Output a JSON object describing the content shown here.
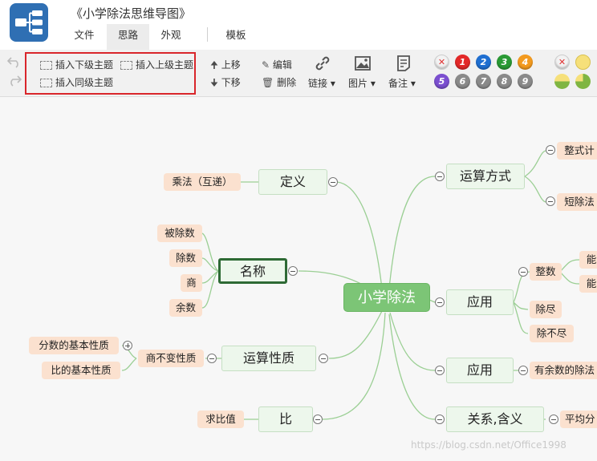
{
  "app": {
    "title": "《小学除法思维导图》"
  },
  "menu_tabs": [
    "文件",
    "思路",
    "外观",
    "模板"
  ],
  "active_tab": "思路",
  "toolbar": {
    "insert_child": "插入下级主题",
    "insert_parent": "插入上级主题",
    "insert_sibling": "插入同级主题",
    "move_up": "上移",
    "move_down": "下移",
    "edit": "编辑",
    "delete": "删除",
    "link": "链接",
    "image": "图片",
    "note": "备注",
    "priorities": [
      "1",
      "2",
      "3",
      "4",
      "5",
      "6",
      "7",
      "8",
      "9"
    ],
    "priority_colors": [
      "#e32828",
      "#1f6fd1",
      "#2a9a35",
      "#f39a1e",
      "#7b4fd0",
      "#8a8a8a",
      "#8a8a8a",
      "#8a8a8a",
      "#8a8a8a"
    ]
  },
  "mindmap": {
    "root": "小学除法",
    "nodes": {
      "definition": "定义",
      "names": "名称",
      "property": "运算性质",
      "ratio": "比",
      "method": "运算方式",
      "application1": "应用",
      "application2": "应用",
      "relation": "关系,含义"
    },
    "leaves": {
      "reciprocal": "乘法（互递）",
      "dividend": "被除数",
      "divisor": "除数",
      "quotient": "商",
      "remainder": "余数",
      "invariant": "商不变性质",
      "fraction_prop": "分数的基本性质",
      "ratio_prop": "比的基本性质",
      "ratio_value": "求比值",
      "integer_calc": "整式计",
      "short_div": "短除法",
      "exact": "整数",
      "can1": "能",
      "can2": "能",
      "divisible": "除尽",
      "not_divisible": "除不尽",
      "with_remainder": "有余数的除法",
      "average": "平均分"
    }
  },
  "watermark": "https://blog.csdn.net/Office1998"
}
